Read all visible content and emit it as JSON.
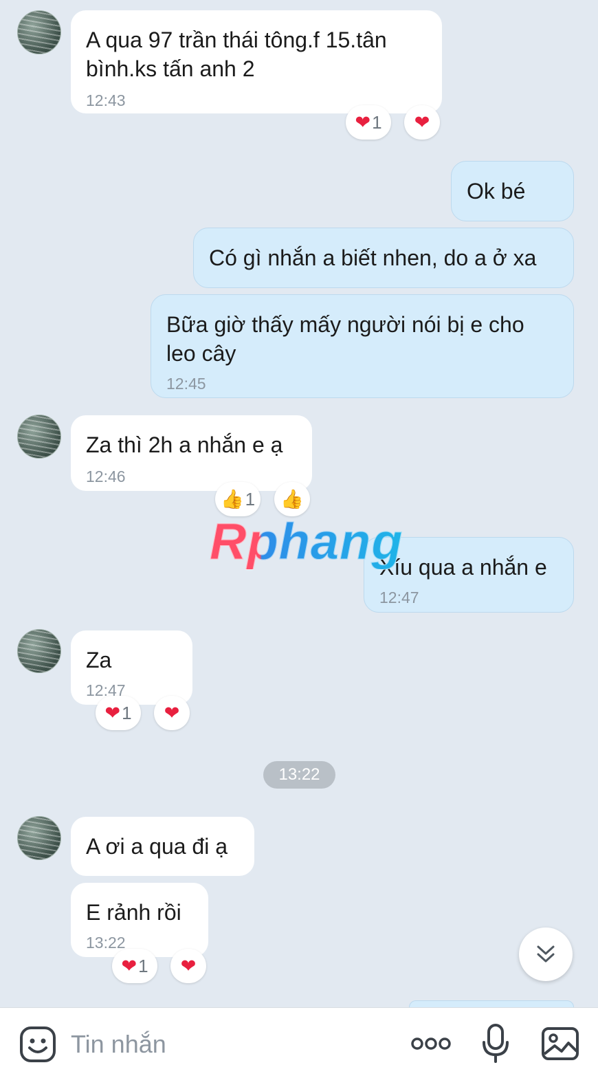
{
  "messages": {
    "m1": {
      "text": "A qua 97 trần thái tông.f 15.tân bình.ks tấn anh 2",
      "time": "12:43"
    },
    "m1_reactions": {
      "summary_count": "1"
    },
    "m2": {
      "text": "Ok bé"
    },
    "m3": {
      "text": "Có gì nhắn a biết nhen, do a ở xa"
    },
    "m4": {
      "text": "Bữa giờ thấy mấy người nói bị e cho leo cây",
      "time": "12:45"
    },
    "m5": {
      "text": "Za thì 2h a nhắn e ạ",
      "time": "12:46"
    },
    "m5_reactions": {
      "summary_count": "1"
    },
    "m6": {
      "text": "Xíu qua a nhắn e",
      "time": "12:47"
    },
    "m7": {
      "text": "Za",
      "time": "12:47"
    },
    "m7_reactions": {
      "summary_count": "1"
    },
    "m8": {
      "text": "A ơi a qua đi ạ"
    },
    "m9": {
      "text": "E rảnh rồi",
      "time": "13:22"
    },
    "m9_reactions": {
      "summary_count": "1"
    }
  },
  "time_separator": "13:22",
  "watermark": "Rphang",
  "input_bar": {
    "placeholder": "Tin nhắn",
    "icons": [
      "sticker-icon",
      "more-icon",
      "microphone-icon",
      "image-icon"
    ]
  },
  "icons": {
    "heart": "❤",
    "thumbs_up": "👍",
    "scroll_down": "double-chevron-down-icon"
  },
  "colors": {
    "background": "#e2e9f1",
    "incoming_bubble": "#ffffff",
    "outgoing_bubble": "#d5ecfb",
    "heart": "#e8203f",
    "timestamp": "#8c96a0"
  }
}
